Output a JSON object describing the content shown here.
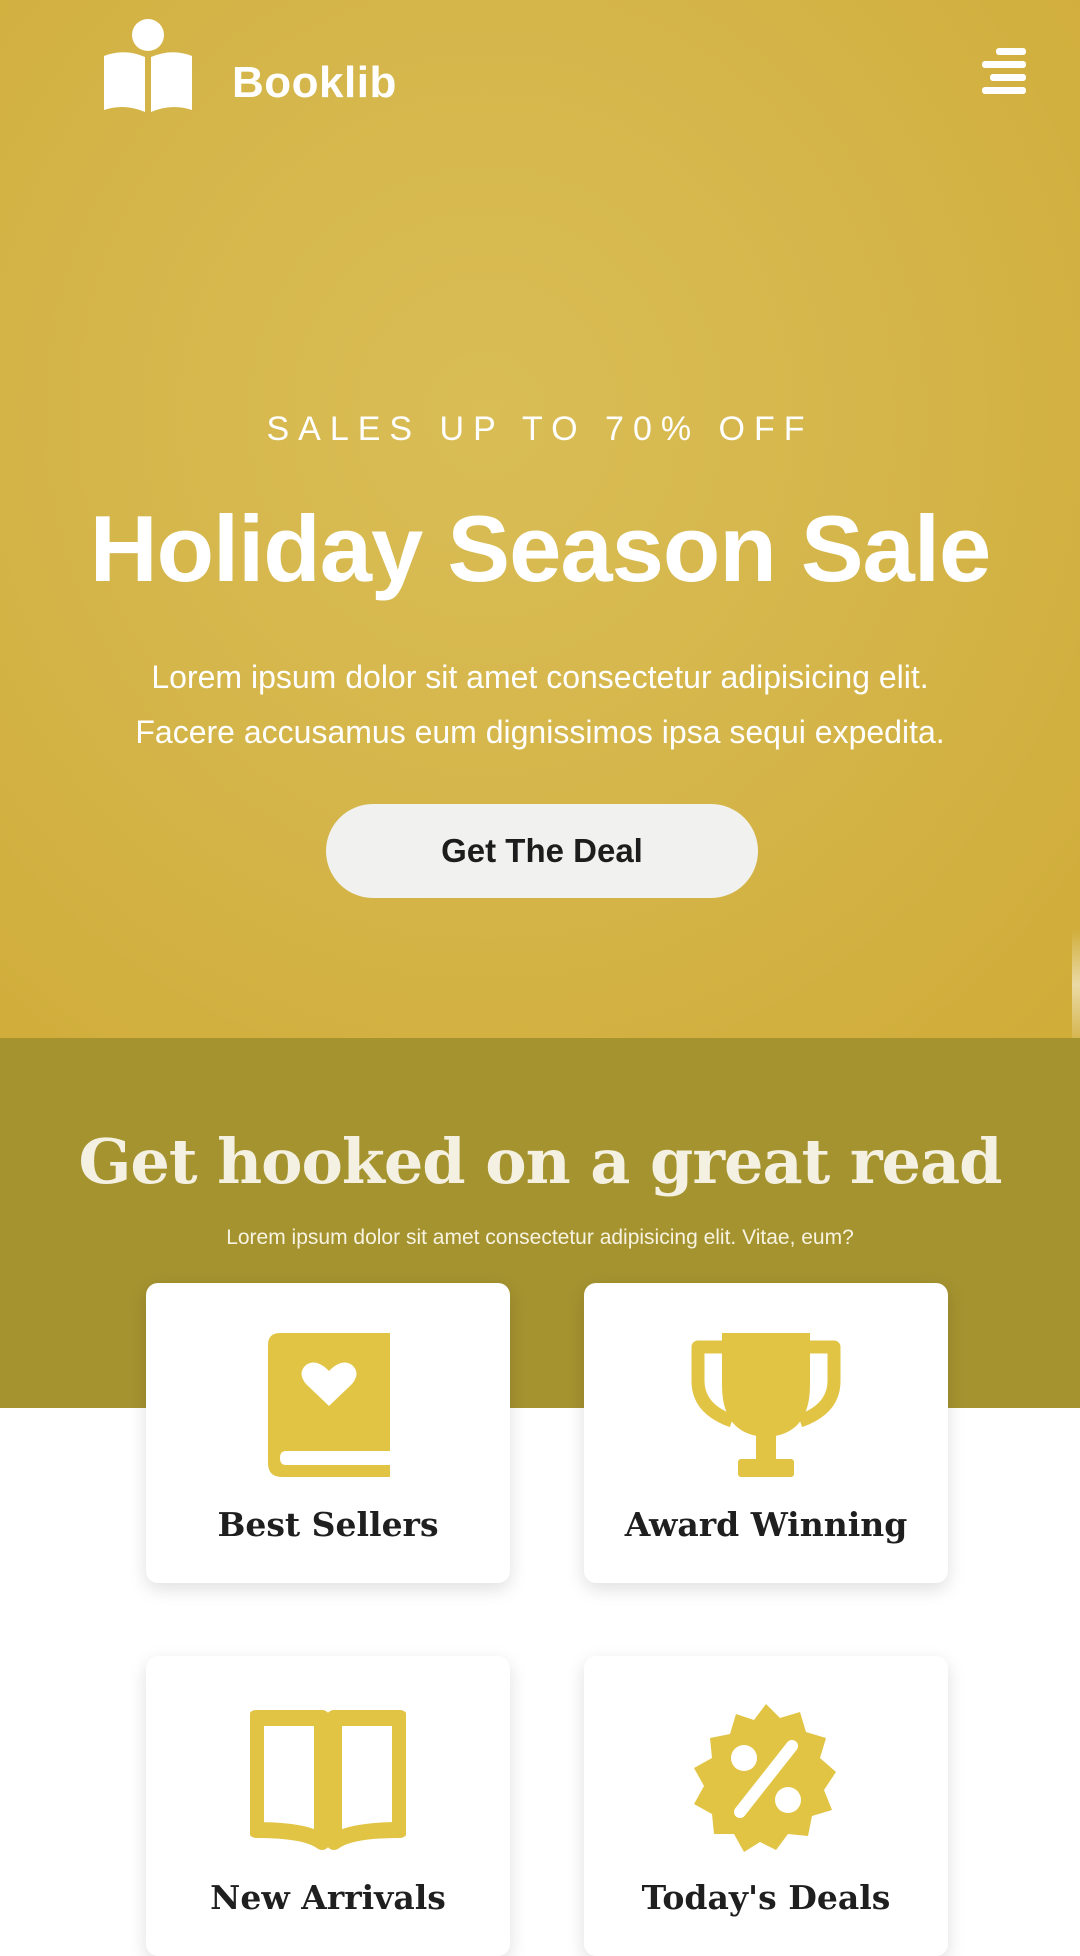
{
  "brand": {
    "name": "Booklib",
    "accent_color": "#e2c444",
    "hero_color": "#d5b64b",
    "band_color": "#a59330"
  },
  "nav": {
    "menu_icon": "hamburger-menu-icon"
  },
  "hero": {
    "eyebrow": "SALES UP TO 70% OFF",
    "title": "Holiday Season Sale",
    "description_line1": "Lorem ipsum dolor sit amet consectetur adipisicing elit.",
    "description_line2": "Facere accusamus eum dignissimos ipsa sequi expedita.",
    "cta_label": "Get The Deal"
  },
  "section": {
    "title": "Get hooked on a great read",
    "subtitle": "Lorem ipsum dolor sit amet consectetur adipisicing elit. Vitae, eum?"
  },
  "categories": [
    {
      "label": "Best Sellers",
      "icon": "book-heart-icon"
    },
    {
      "label": "Award Winning",
      "icon": "trophy-icon"
    },
    {
      "label": "New Arrivals",
      "icon": "open-book-icon"
    },
    {
      "label": "Today's Deals",
      "icon": "percent-badge-icon"
    }
  ]
}
